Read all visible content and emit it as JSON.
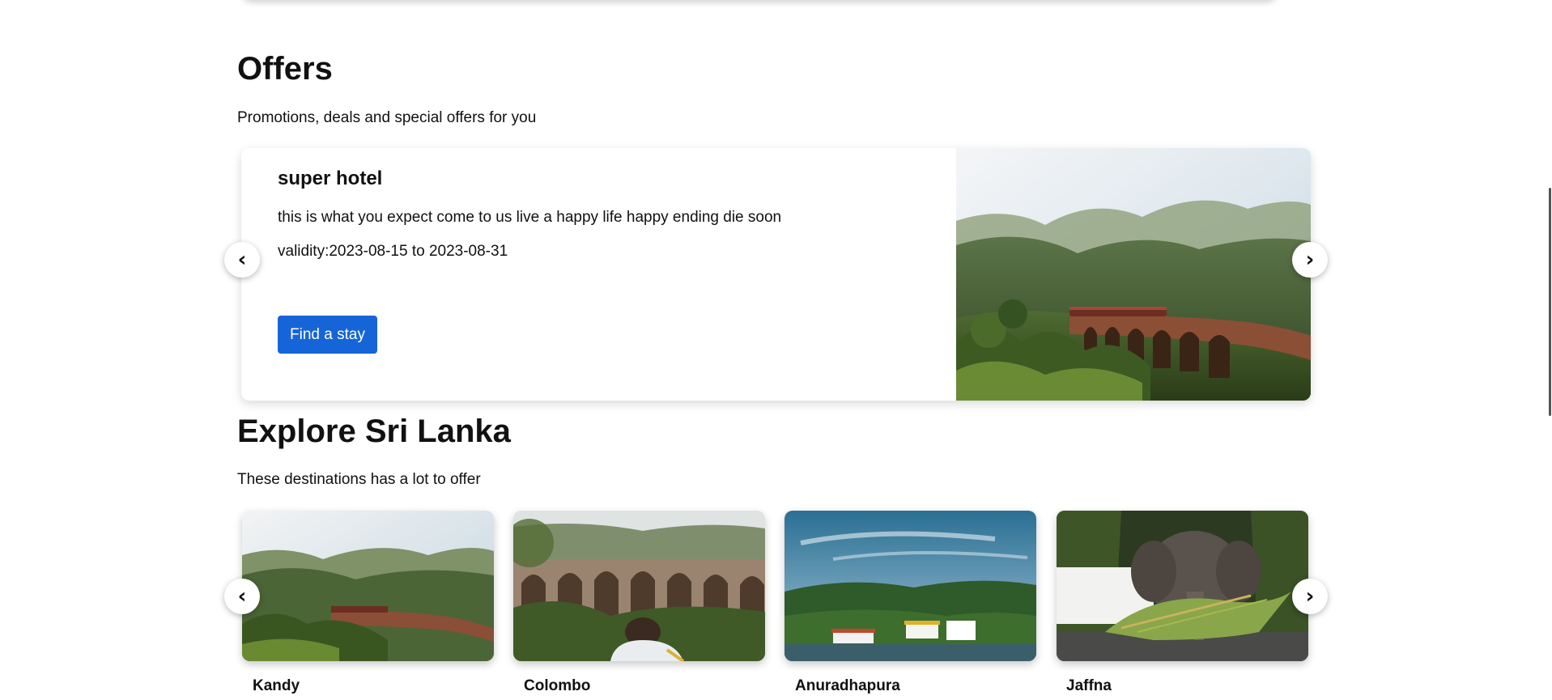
{
  "offers": {
    "title": "Offers",
    "subtitle": "Promotions, deals and special offers for you",
    "current": {
      "name": "super hotel",
      "description": "this is what you expect come to us live a happy life happy ending die soon",
      "validity": "validity:2023-08-15 to 2023-08-31",
      "button_label": "Find a stay"
    },
    "prev_glyph": "‹",
    "next_glyph": "›"
  },
  "explore": {
    "title": "Explore Sri Lanka",
    "subtitle": "These destinations has a lot to offer",
    "destinations": [
      {
        "name": "Kandy",
        "image": "train-on-arch-bridge"
      },
      {
        "name": "Colombo",
        "image": "person-viewing-arch-bridge"
      },
      {
        "name": "Anuradhapura",
        "image": "lakeside-hills-town"
      },
      {
        "name": "Jaffna",
        "image": "elephant-eating-leaves"
      }
    ],
    "prev_glyph": "‹",
    "next_glyph": "›"
  },
  "icons": {
    "prev": "chevron-left-icon",
    "next": "chevron-right-icon"
  },
  "colors": {
    "primary_button": "#1565d8",
    "text": "#111111",
    "background": "#ffffff"
  }
}
